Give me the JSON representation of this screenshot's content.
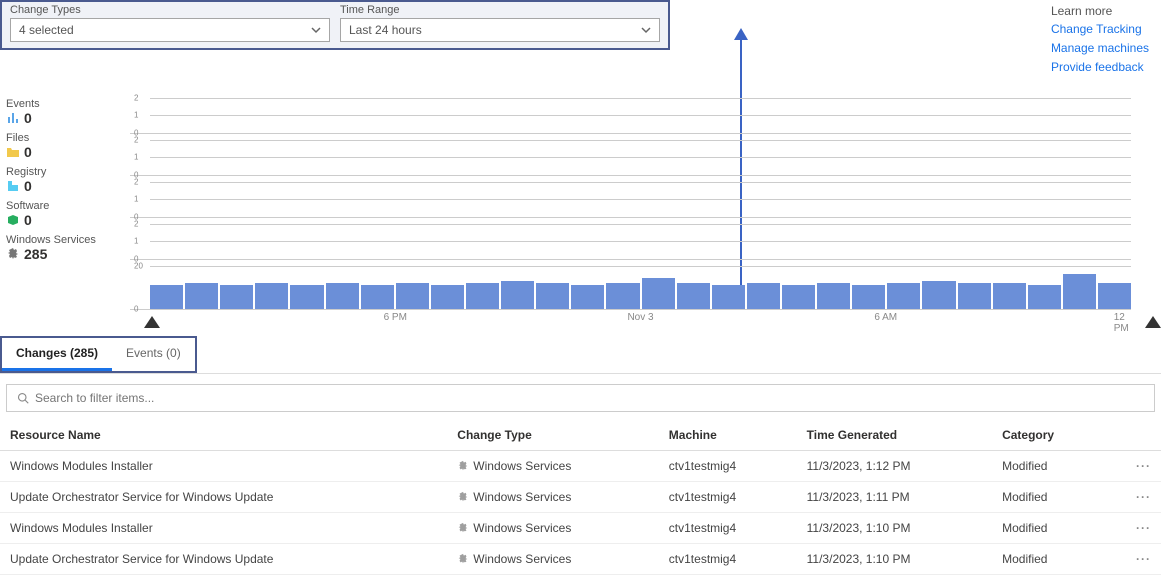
{
  "filters": {
    "changeTypes": {
      "label": "Change Types",
      "value": "4 selected"
    },
    "timeRange": {
      "label": "Time Range",
      "value": "Last 24 hours"
    }
  },
  "learn": {
    "title": "Learn more",
    "links": [
      "Change Tracking",
      "Manage machines",
      "Provide feedback"
    ]
  },
  "summary": [
    {
      "label": "Events",
      "value": "0",
      "icon": "chart-icon",
      "color": "#5aa5e8"
    },
    {
      "label": "Files",
      "value": "0",
      "icon": "folder-icon",
      "color": "#f2c94c"
    },
    {
      "label": "Registry",
      "value": "0",
      "icon": "registry-icon",
      "color": "#56ccf2"
    },
    {
      "label": "Software",
      "value": "0",
      "icon": "package-icon",
      "color": "#27ae60"
    },
    {
      "label": "Windows Services",
      "value": "285",
      "icon": "gear-icon",
      "color": "#777"
    }
  ],
  "chart_data": [
    {
      "type": "bar",
      "label": "Events",
      "yticks": [
        0,
        1,
        2
      ],
      "values": []
    },
    {
      "type": "bar",
      "label": "Files",
      "yticks": [
        0,
        1,
        2
      ],
      "values": []
    },
    {
      "type": "bar",
      "label": "Registry",
      "yticks": [
        0,
        1,
        2
      ],
      "values": []
    },
    {
      "type": "bar",
      "label": "Software",
      "yticks": [
        0,
        1,
        2
      ],
      "values": []
    },
    {
      "type": "bar",
      "label": "Windows Services",
      "yticks": [
        0,
        20
      ],
      "values": [
        11,
        12,
        11,
        12,
        11,
        12,
        11,
        12,
        11,
        12,
        13,
        12,
        11,
        12,
        14,
        12,
        11,
        12,
        11,
        12,
        11,
        12,
        13,
        12,
        12,
        11,
        16,
        12
      ]
    }
  ],
  "xaxis": [
    "6 PM",
    "Nov 3",
    "6 AM",
    "12 PM"
  ],
  "tabs": [
    {
      "label": "Changes (285)",
      "active": true
    },
    {
      "label": "Events (0)",
      "active": false
    }
  ],
  "search": {
    "placeholder": "Search to filter items..."
  },
  "table": {
    "headers": [
      "Resource Name",
      "Change Type",
      "Machine",
      "Time Generated",
      "Category"
    ],
    "rows": [
      {
        "name": "Windows Modules Installer",
        "type": "Windows Services",
        "machine": "ctv1testmig4",
        "time": "11/3/2023, 1:12 PM",
        "cat": "Modified"
      },
      {
        "name": "Update Orchestrator Service for Windows Update",
        "type": "Windows Services",
        "machine": "ctv1testmig4",
        "time": "11/3/2023, 1:11 PM",
        "cat": "Modified"
      },
      {
        "name": "Windows Modules Installer",
        "type": "Windows Services",
        "machine": "ctv1testmig4",
        "time": "11/3/2023, 1:10 PM",
        "cat": "Modified"
      },
      {
        "name": "Update Orchestrator Service for Windows Update",
        "type": "Windows Services",
        "machine": "ctv1testmig4",
        "time": "11/3/2023, 1:10 PM",
        "cat": "Modified"
      }
    ]
  }
}
